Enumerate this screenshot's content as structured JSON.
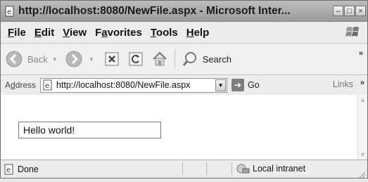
{
  "window": {
    "title": "http://localhost:8080/NewFile.aspx - Microsoft Inter...",
    "buttons": {
      "minimize": "–",
      "maximize": "□",
      "close": "×"
    }
  },
  "menu": {
    "items": [
      {
        "accel": "F",
        "rest": "ile"
      },
      {
        "accel": "E",
        "rest": "dit"
      },
      {
        "accel": "V",
        "rest": "iew"
      },
      {
        "pre": "F",
        "accel": "a",
        "rest": "vorites"
      },
      {
        "accel": "T",
        "rest": "ools"
      },
      {
        "accel": "H",
        "rest": "elp"
      }
    ]
  },
  "toolbar": {
    "back_label": "Back",
    "search_label": "Search",
    "overflow": "»"
  },
  "address": {
    "label_accel": "d",
    "label_pre": "A",
    "label_rest": "dress",
    "url": "http://localhost:8080/NewFile.aspx",
    "go_label": "Go",
    "links_label": "Links",
    "overflow": "»"
  },
  "page": {
    "textbox_value": "Hello world!"
  },
  "status": {
    "text": "Done",
    "zone": "Local intranet"
  },
  "icons": [
    "ie-page-icon",
    "windows-logo-icon",
    "back-icon",
    "forward-icon",
    "stop-icon",
    "refresh-icon",
    "home-icon",
    "search-icon",
    "go-arrow-icon",
    "done-page-icon",
    "intranet-icon"
  ]
}
